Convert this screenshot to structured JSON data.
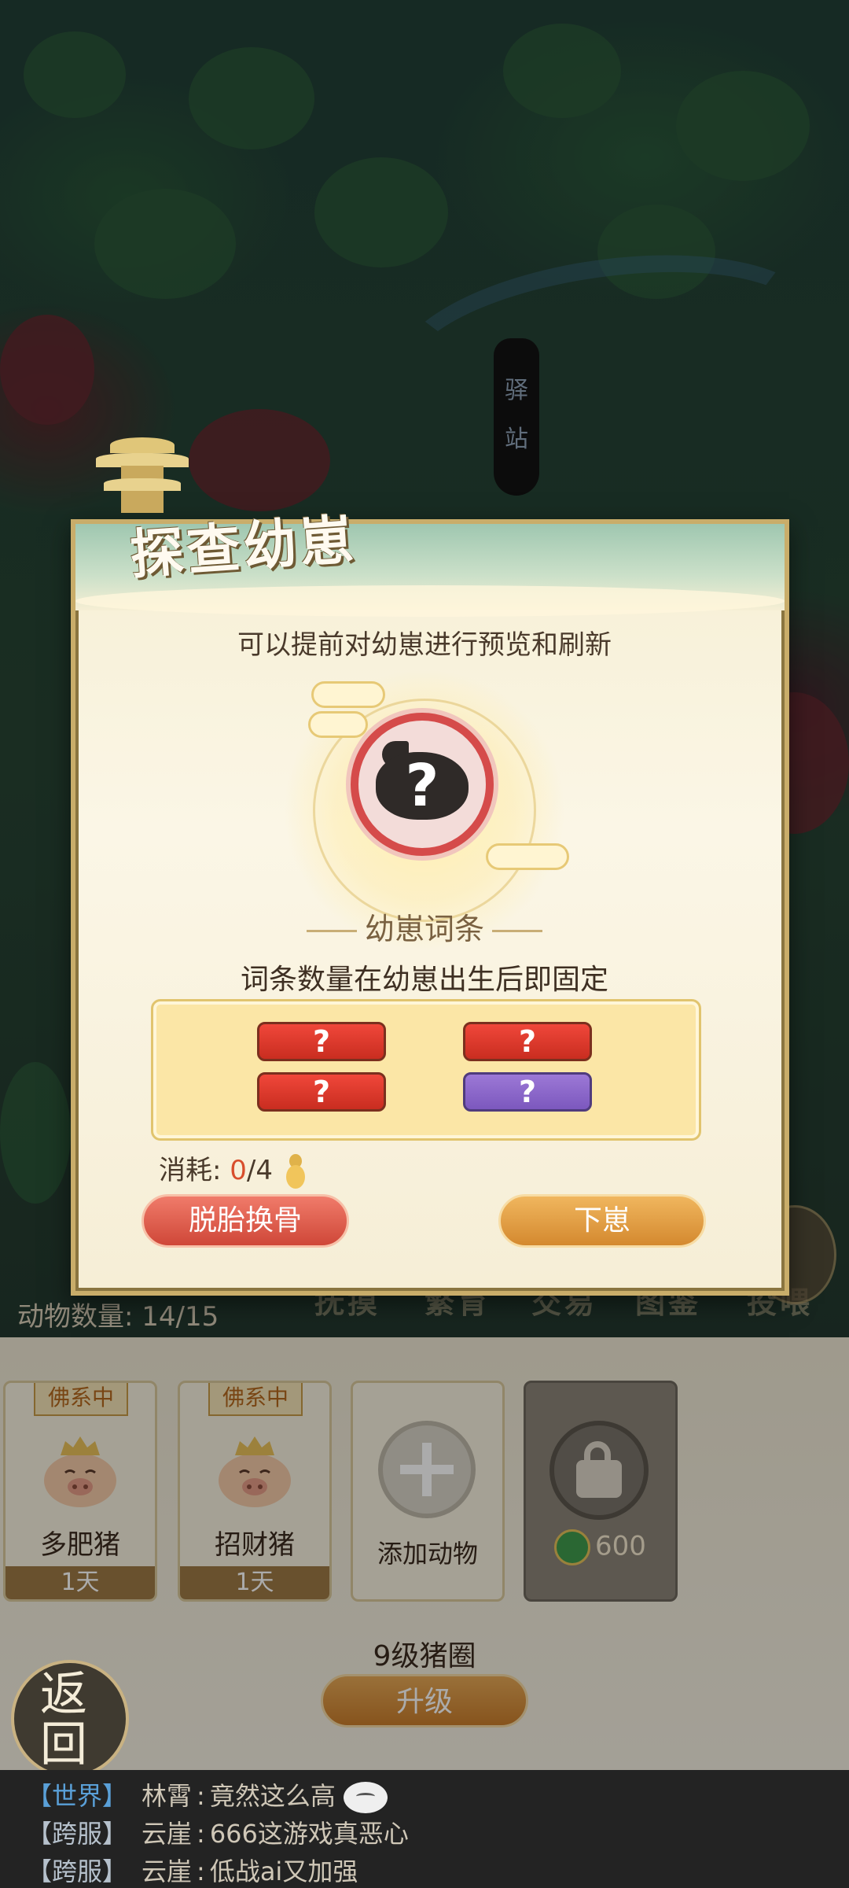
{
  "scene": {
    "signpost_text": "驿站",
    "animal_count_label": "动物数量:",
    "animal_count_value": "14/15",
    "ambient_tabs": [
      "抚摸",
      "繁育",
      "交易",
      "图鉴",
      "投喂"
    ]
  },
  "modal": {
    "title": "探查幼崽",
    "subtitle": "可以提前对幼崽进行预览和刷新",
    "mystery_mark": "?",
    "traits_section_title": "幼崽词条",
    "traits_description": "词条数量在幼崽出生后即固定",
    "traits": [
      {
        "label": "?",
        "color": "#d8382b"
      },
      {
        "label": "?",
        "color": "#d8382b"
      },
      {
        "label": "?",
        "color": "#d8382b"
      },
      {
        "label": "?",
        "color": "#8a66c8"
      }
    ],
    "cost_label": "消耗:",
    "cost_current": "0",
    "cost_sep": "/",
    "cost_required": "4",
    "rebirth_button": "脱胎换骨",
    "give_birth_button": "下崽"
  },
  "pen": {
    "slots": [
      {
        "status": "佛系中",
        "name": "多肥猪",
        "days": "1天"
      },
      {
        "status": "佛系中",
        "name": "招财猪",
        "days": "1天"
      }
    ],
    "add_label": "添加动物",
    "locked_price": "600",
    "level_label": "9级猪圈",
    "upgrade_button": "升级",
    "back_button": "返回"
  },
  "chat": [
    {
      "channel": "【世界】",
      "user": "林霄",
      "sep": ":",
      "message": "竟然这么高",
      "has_emoji": true
    },
    {
      "channel": "【跨服】",
      "user": "云崖",
      "sep": ":",
      "message": "666这游戏真恶心",
      "has_emoji": false
    },
    {
      "channel": "【跨服】",
      "user": "云崖",
      "sep": ":",
      "message": "低战ai又加强",
      "has_emoji": false
    }
  ],
  "colors": {
    "accent_gold": "#d4892f",
    "accent_red": "#cf4738",
    "cost_zero": "#d84e2c"
  }
}
